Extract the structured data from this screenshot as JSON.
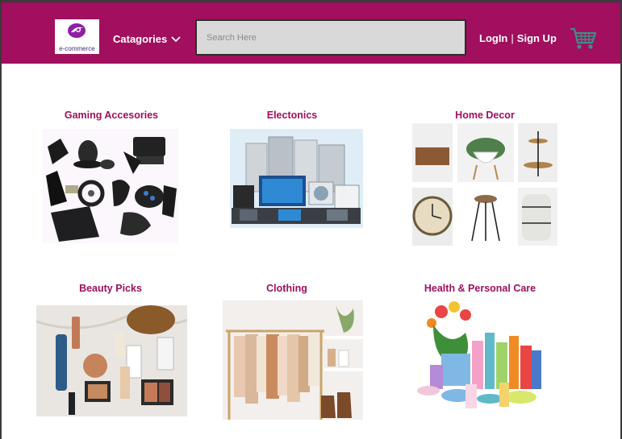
{
  "header": {
    "logo_text": "e-commerce",
    "categories_label": "Catagories",
    "search_placeholder": "Search Here",
    "login_label": "LogIn",
    "separator": "|",
    "signup_label": "Sign Up"
  },
  "categories": [
    {
      "title": "Gaming Accesories"
    },
    {
      "title": "Electonics"
    },
    {
      "title": "Home Decor"
    },
    {
      "title": "Beauty Picks"
    },
    {
      "title": "Clothing"
    },
    {
      "title": "Health & Personal Care"
    }
  ],
  "colors": {
    "brand": "#a10f5e",
    "header_text": "#ffffff",
    "search_bg": "#d9d9d9",
    "cart_icon": "#3a8f86"
  },
  "icons": [
    "logo-icon",
    "chevron-down-icon",
    "cart-icon"
  ]
}
